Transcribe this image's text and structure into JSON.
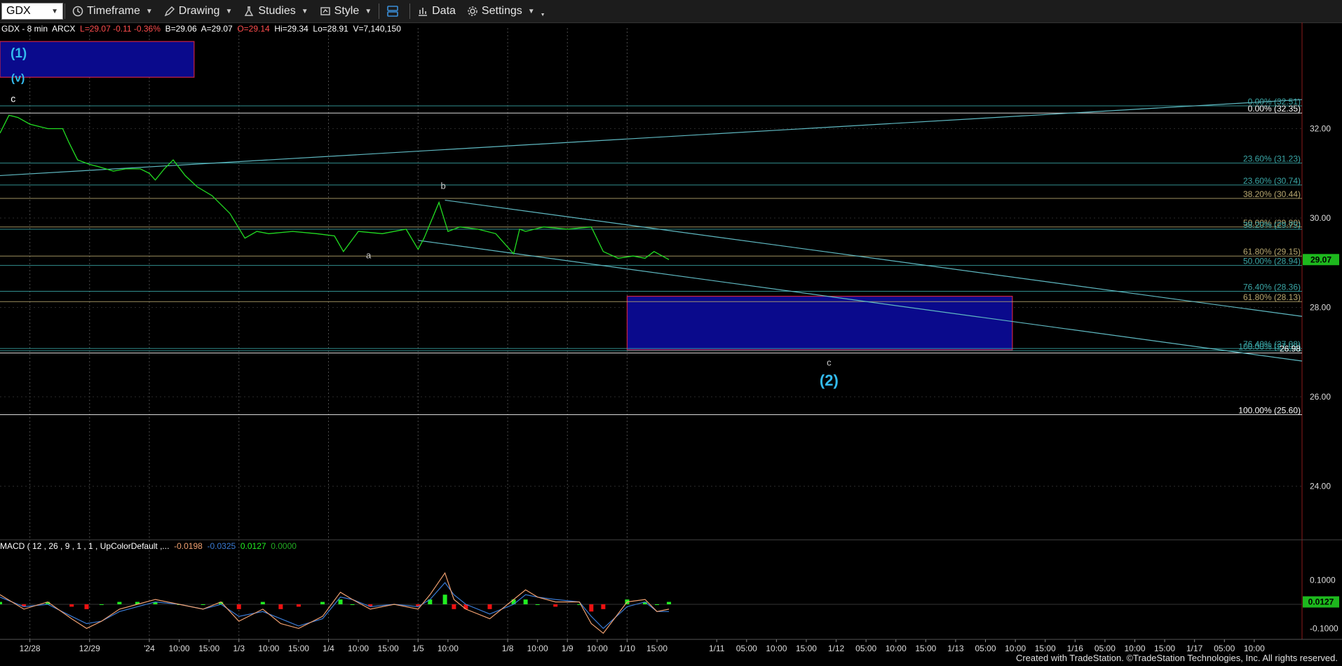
{
  "toolbar": {
    "symbol": "GDX",
    "timeframe": "Timeframe",
    "drawing": "Drawing",
    "studies": "Studies",
    "style": "Style",
    "data": "Data",
    "settings": "Settings"
  },
  "footer": "Created with TradeStation. ©TradeStation Technologies, Inc. All rights reserved.",
  "colors": {
    "price": "#22dd22",
    "wave_label": "#33bbee",
    "box_blue": "#0a0a8c",
    "box_border": "#cc2244",
    "trend": "#5fb9c2",
    "fib_teal": "#3aa7a7",
    "fib_tan": "#b8a870",
    "macd_up": "#22ee22",
    "macd_down": "#ee1111",
    "macd_line": "#f0a070",
    "signal_line": "#3a7bd5"
  },
  "chart_data": {
    "type": "line",
    "header": {
      "parts": [
        {
          "text": "GDX - 8 min  ARCX  ",
          "color": "#ffffff"
        },
        {
          "text": "L=29.07 -0.11 -0.36%",
          "color": "#ff4d4d"
        },
        {
          "text": "  B=29.06  A=29.07  ",
          "color": "#ffffff"
        },
        {
          "text": "O=29.14",
          "color": "#ff4d4d"
        },
        {
          "text": "  Hi=29.34  Lo=28.91  V=7,140,150",
          "color": "#ffffff"
        }
      ]
    },
    "ylim": [
      22.8,
      34.0
    ],
    "y_ticks": [
      "32.00",
      "30.00",
      "28.00",
      "26.00",
      "24.00"
    ],
    "y_tick_values": [
      32,
      30,
      28,
      26,
      24
    ],
    "x_labels": [
      "12/28",
      "12/29",
      "'24",
      "10:00",
      "15:00",
      "1/3",
      "10:00",
      "15:00",
      "1/4",
      "10:00",
      "15:00",
      "1/5",
      "10:00",
      "1/8",
      "10:00",
      "1/9",
      "10:00",
      "1/10",
      "15:00",
      "1/11",
      "05:00",
      "10:00",
      "15:00",
      "1/12",
      "05:00",
      "10:00",
      "15:00",
      "1/13",
      "05:00",
      "10:00",
      "15:00",
      "1/16",
      "05:00",
      "10:00",
      "15:00",
      "1/17",
      "05:00",
      "10:00"
    ],
    "x_positions": [
      0.5,
      1.5,
      2.5,
      3.0,
      3.5,
      4.0,
      4.5,
      5.0,
      5.5,
      6.0,
      6.5,
      7.0,
      7.5,
      8.5,
      9.0,
      9.5,
      10.0,
      10.5,
      11.0,
      12.0,
      12.5,
      13.0,
      13.5,
      14.0,
      14.5,
      15.0,
      15.5,
      16.0,
      16.5,
      17.0,
      17.5,
      18.0,
      18.5,
      19.0,
      19.5,
      20.0,
      20.5,
      21.0
    ],
    "xlim": [
      0,
      21.8
    ],
    "price_series": {
      "name": "GDX",
      "x": [
        0.0,
        0.15,
        0.3,
        0.5,
        0.8,
        1.05,
        1.15,
        1.3,
        1.5,
        1.65,
        1.9,
        2.1,
        2.35,
        2.5,
        2.6,
        2.75,
        2.9,
        3.1,
        3.3,
        3.55,
        3.85,
        4.1,
        4.3,
        4.5,
        4.9,
        5.3,
        5.6,
        5.75,
        6.0,
        6.4,
        6.8,
        7.0,
        7.1,
        7.35,
        7.5,
        7.7,
        8.0,
        8.3,
        8.6,
        8.7,
        8.8,
        9.1,
        9.5,
        9.9,
        10.1,
        10.35,
        10.6,
        10.8,
        10.95,
        11.2
      ],
      "y": [
        31.9,
        32.3,
        32.25,
        32.1,
        32.0,
        32.0,
        31.7,
        31.3,
        31.2,
        31.15,
        31.05,
        31.1,
        31.1,
        31.0,
        30.85,
        31.1,
        31.3,
        30.95,
        30.7,
        30.5,
        30.1,
        29.55,
        29.7,
        29.65,
        29.7,
        29.65,
        29.6,
        29.25,
        29.7,
        29.65,
        29.75,
        29.3,
        29.55,
        30.35,
        29.7,
        29.8,
        29.75,
        29.65,
        29.2,
        29.75,
        29.7,
        29.8,
        29.75,
        29.8,
        29.25,
        29.1,
        29.15,
        29.1,
        29.25,
        29.07
      ]
    },
    "current_price_label": "29.07",
    "fib_levels": [
      {
        "value": 32.51,
        "label": "0.00% (32.51)",
        "color": "#3aa7a7"
      },
      {
        "value": 32.35,
        "label": "0.00% (32.35)",
        "color": "#ffffff"
      },
      {
        "value": 31.23,
        "label": "23.60% (31.23)",
        "color": "#3aa7a7"
      },
      {
        "value": 30.74,
        "label": "23.60% (30.74)",
        "color": "#3aa7a7"
      },
      {
        "value": 30.44,
        "label": "38.20% (30.44)",
        "color": "#b8a870"
      },
      {
        "value": 29.8,
        "label": "50.00% (29.80)",
        "color": "#b8a870"
      },
      {
        "value": 29.75,
        "label": "38.20% (29.75)",
        "color": "#3aa7a7"
      },
      {
        "value": 29.15,
        "label": "61.80% (29.15)",
        "color": "#b8a870"
      },
      {
        "value": 28.94,
        "label": "50.00% (28.94)",
        "color": "#3aa7a7"
      },
      {
        "value": 28.36,
        "label": "76.40% (28.36)",
        "color": "#3aa7a7"
      },
      {
        "value": 28.13,
        "label": "61.80% (28.13)",
        "color": "#b8a870"
      },
      {
        "value": 27.08,
        "label": "76.40% (27.08)",
        "color": "#3aa7a7"
      },
      {
        "value": 27.03,
        "label": "100.00% (27.03)",
        "color": "#3aa7a7"
      },
      {
        "value": 26.98,
        "label": "26.98",
        "color": "#ffffff"
      },
      {
        "value": 25.6,
        "label": "100.00% (25.60)",
        "color": "#ffffff"
      }
    ],
    "trend_lines": [
      {
        "x": [
          0,
          21.8
        ],
        "y": [
          30.95,
          32.65
        ]
      },
      {
        "x": [
          7.45,
          21.8
        ],
        "y": [
          30.4,
          27.8
        ]
      },
      {
        "x": [
          7.0,
          21.8
        ],
        "y": [
          29.5,
          26.8
        ]
      }
    ],
    "boxes": [
      {
        "x": [
          0,
          3.25
        ],
        "y": [
          33.15,
          33.95
        ],
        "label": "(1)"
      },
      {
        "x": [
          10.5,
          16.95
        ],
        "y": [
          27.05,
          28.25
        ],
        "label": ""
      }
    ],
    "annotations": [
      {
        "text": "(v)",
        "x": 0.3,
        "y": 33.05,
        "color": "#33bbee",
        "size": 16
      },
      {
        "text": "c",
        "x": 0.22,
        "y": 32.6,
        "color": "#ffffff",
        "size": 14
      },
      {
        "text": "b",
        "x": 7.42,
        "y": 30.65,
        "color": "#cccccc",
        "size": 13
      },
      {
        "text": "a",
        "x": 6.17,
        "y": 29.1,
        "color": "#cccccc",
        "size": 13
      },
      {
        "text": "c",
        "x": 13.88,
        "y": 26.7,
        "color": "#cccccc",
        "size": 13
      },
      {
        "text": "(2)",
        "x": 13.88,
        "y": 26.25,
        "color": "#33bbee",
        "size": 22
      }
    ],
    "macd": {
      "label_parts": [
        {
          "text": "MACD ( 12 , 26 , 9 , 1 , 1 , UpColorDefault ,...",
          "color": "#ffffff"
        },
        {
          "text": "  -0.0198",
          "color": "#f0a070"
        },
        {
          "text": "  -0.0325",
          "color": "#3a7bd5"
        },
        {
          "text": "  0.0127",
          "color": "#22ee22"
        },
        {
          "text": "  0.0000",
          "color": "#22aa22"
        }
      ],
      "ylim": [
        -0.16,
        0.16
      ],
      "y_ticks": [
        "0.1000",
        "-0.1000"
      ],
      "y_tick_values": [
        0.1,
        -0.1
      ],
      "current_label": "0.0127",
      "x": [
        0.0,
        0.4,
        0.8,
        1.2,
        1.45,
        1.7,
        2.0,
        2.3,
        2.6,
        3.0,
        3.4,
        3.7,
        4.0,
        4.4,
        4.7,
        5.0,
        5.4,
        5.7,
        5.9,
        6.2,
        6.6,
        7.0,
        7.2,
        7.45,
        7.6,
        7.8,
        8.2,
        8.6,
        8.8,
        9.0,
        9.3,
        9.7,
        9.9,
        10.1,
        10.5,
        10.8,
        11.0,
        11.2
      ],
      "macd_line": [
        0.04,
        -0.02,
        0.01,
        -0.06,
        -0.1,
        -0.07,
        -0.02,
        0.0,
        0.02,
        0.0,
        -0.02,
        0.01,
        -0.07,
        -0.02,
        -0.08,
        -0.1,
        -0.05,
        0.05,
        0.02,
        -0.02,
        0.0,
        -0.02,
        0.04,
        0.13,
        0.02,
        -0.02,
        -0.06,
        0.02,
        0.06,
        0.03,
        0.01,
        0.01,
        -0.08,
        -0.12,
        0.01,
        0.02,
        -0.03,
        -0.02
      ],
      "signal_line": [
        0.03,
        -0.01,
        0.0,
        -0.05,
        -0.08,
        -0.07,
        -0.03,
        -0.01,
        0.01,
        0.0,
        -0.02,
        0.0,
        -0.05,
        -0.03,
        -0.06,
        -0.09,
        -0.06,
        0.03,
        0.02,
        -0.01,
        0.0,
        -0.01,
        0.02,
        0.09,
        0.04,
        0.0,
        -0.04,
        0.0,
        0.04,
        0.03,
        0.02,
        0.01,
        -0.05,
        -0.1,
        -0.01,
        0.01,
        -0.03,
        -0.03
      ],
      "histogram": [
        0.01,
        -0.01,
        0.01,
        -0.01,
        -0.02,
        0.0,
        0.01,
        0.01,
        0.01,
        0.0,
        0.0,
        0.01,
        -0.02,
        0.01,
        -0.02,
        -0.01,
        0.01,
        0.02,
        0.0,
        -0.01,
        0.0,
        -0.01,
        0.02,
        0.04,
        -0.02,
        -0.02,
        -0.02,
        0.02,
        0.02,
        0.0,
        -0.01,
        0.0,
        -0.03,
        -0.02,
        0.02,
        0.01,
        0.0,
        0.01
      ]
    }
  }
}
